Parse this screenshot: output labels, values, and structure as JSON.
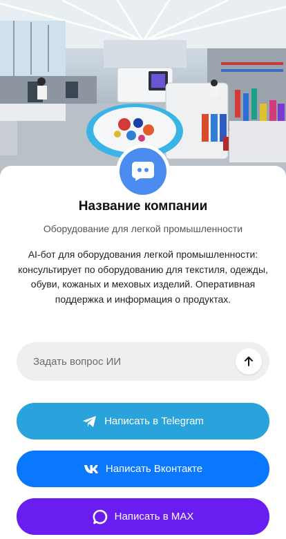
{
  "company": {
    "name": "Название компании",
    "subtitle": "Оборудование для легкой промышленности",
    "description": "AI-бот для оборудования легкой промышленности: консультирует по оборудованию для текстиля, одежды, обуви, кожаных и меховых изделий. Оперативная поддержка и информация о продуктах."
  },
  "hero": {
    "icon": "embroidery-factory-image"
  },
  "avatar": {
    "icon": "chat-bot-icon",
    "color": "#4a8cf0"
  },
  "ask": {
    "placeholder": "Задать вопрос ИИ",
    "value": "",
    "send_icon": "arrow-up-icon"
  },
  "buttons": {
    "telegram": {
      "label": "Написать в Telegram",
      "icon": "telegram-icon",
      "color": "#2aa3dd"
    },
    "vk": {
      "label": "Написать Вконтакте",
      "icon": "vk-icon",
      "color": "#0a77ff"
    },
    "max": {
      "label": "Написать в MAX",
      "icon": "max-icon",
      "color": "#6a1df0"
    }
  }
}
